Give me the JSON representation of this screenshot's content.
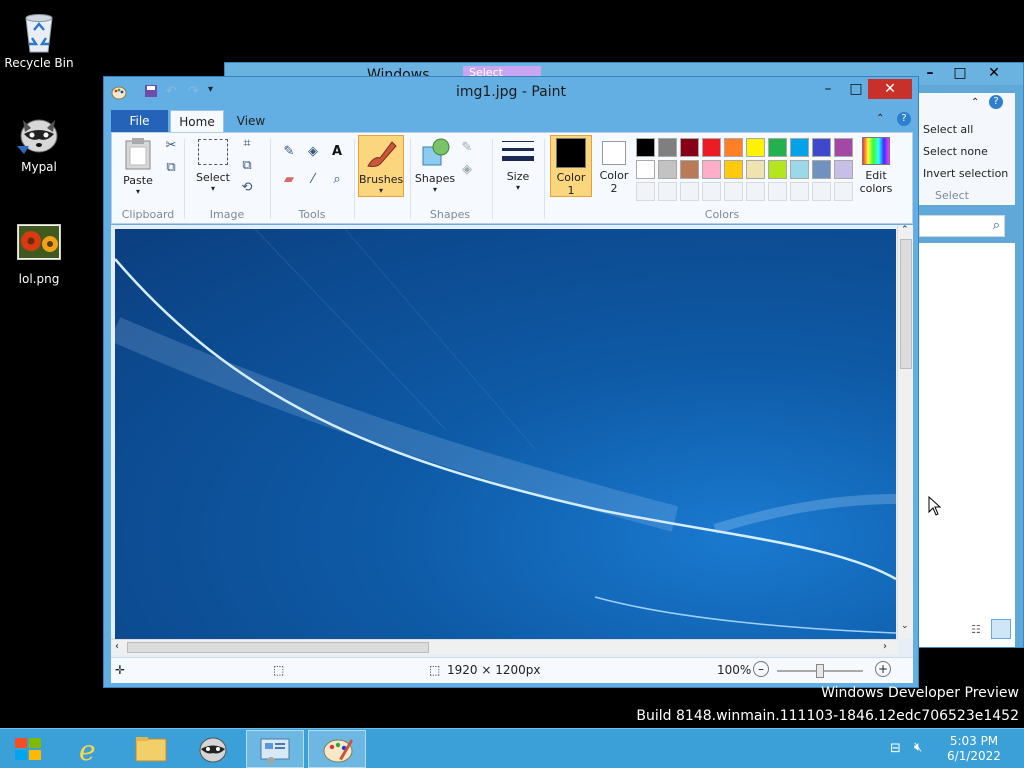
{
  "desktop": {
    "icons": [
      {
        "label": "Recycle Bin"
      },
      {
        "label": "Mypal"
      },
      {
        "label": "lol.png"
      }
    ],
    "watermark": {
      "line1": "Windows Developer Preview",
      "line2": "Build 8148.winmain.111103-1846.12edc706523e1452"
    }
  },
  "explorer": {
    "title": "Windows",
    "tab_partial": "Select",
    "select_group": {
      "items": [
        "Select all",
        "Select none",
        "Invert selection"
      ],
      "label": "Select"
    }
  },
  "paint": {
    "title": "img1.jpg - Paint",
    "tabs": {
      "file": "File",
      "home": "Home",
      "view": "View"
    },
    "ribbon": {
      "clipboard": {
        "paste": "Paste",
        "label": "Clipboard"
      },
      "image": {
        "select": "Select",
        "label": "Image"
      },
      "tools": {
        "label": "Tools"
      },
      "brushes": {
        "label": "Brushes"
      },
      "shapes": {
        "shapes": "Shapes",
        "label": "Shapes"
      },
      "size": {
        "label": "Size"
      },
      "colors": {
        "color1_line1": "Color",
        "color1_line2": "1",
        "color2_line1": "Color",
        "color2_line2": "2",
        "edit_line1": "Edit",
        "edit_line2": "colors",
        "label": "Colors",
        "color1_value": "#000000",
        "color2_value": "#ffffff",
        "palette_row1": [
          "#000000",
          "#7f7f7f",
          "#880015",
          "#ed1c24",
          "#ff7f27",
          "#fff200",
          "#22b14c",
          "#00a2e8",
          "#3f48cc",
          "#a349a4"
        ],
        "palette_row2": [
          "#ffffff",
          "#c3c3c3",
          "#b97a57",
          "#ffaec9",
          "#ffc90e",
          "#efe4b0",
          "#b5e61d",
          "#99d9ea",
          "#7092be",
          "#c8bfe7"
        ]
      }
    },
    "status": {
      "dimensions": "1920 × 1200px",
      "zoom": "100%"
    }
  },
  "taskbar": {
    "clock_time": "5:03 PM",
    "clock_date": "6/1/2022"
  }
}
